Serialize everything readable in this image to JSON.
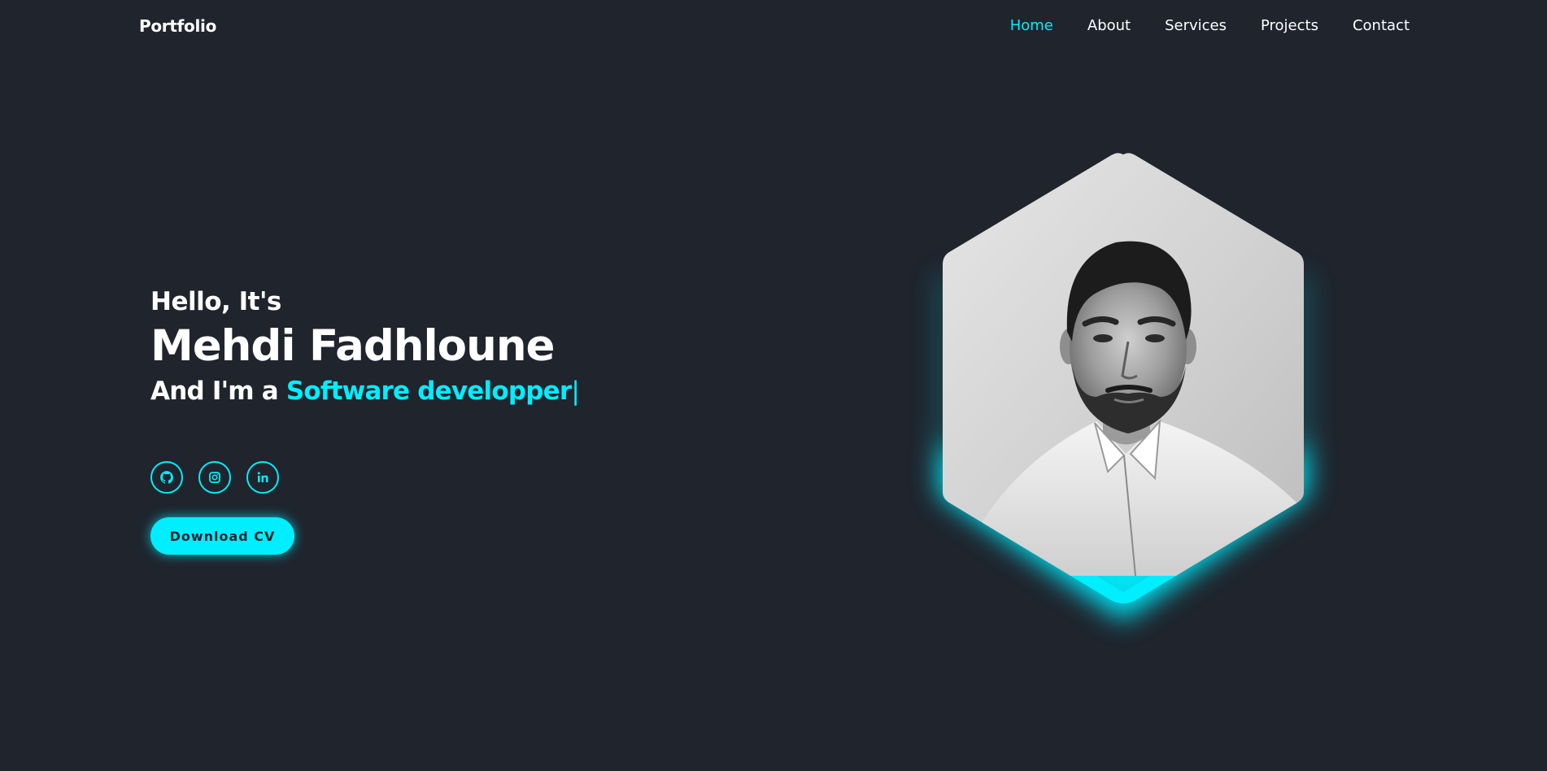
{
  "header": {
    "logo": "Portfolio",
    "nav": [
      {
        "label": "Home",
        "active": true
      },
      {
        "label": "About",
        "active": false
      },
      {
        "label": "Services",
        "active": false
      },
      {
        "label": "Projects",
        "active": false
      },
      {
        "label": "Contact",
        "active": false
      }
    ]
  },
  "hero": {
    "greeting": "Hello, It's",
    "name": "Mehdi Fadhloune",
    "role_prefix": "And I'm a ",
    "role_typed": "Software developper",
    "cursor": "|",
    "socials": [
      {
        "icon": "github-icon"
      },
      {
        "icon": "instagram-icon"
      },
      {
        "icon": "linkedin-icon"
      }
    ],
    "cv_button": "Download CV",
    "photo_icon": "profile-portrait"
  },
  "colors": {
    "background": "#1f242d",
    "accent": "#00eeff",
    "text": "#ffffff"
  }
}
